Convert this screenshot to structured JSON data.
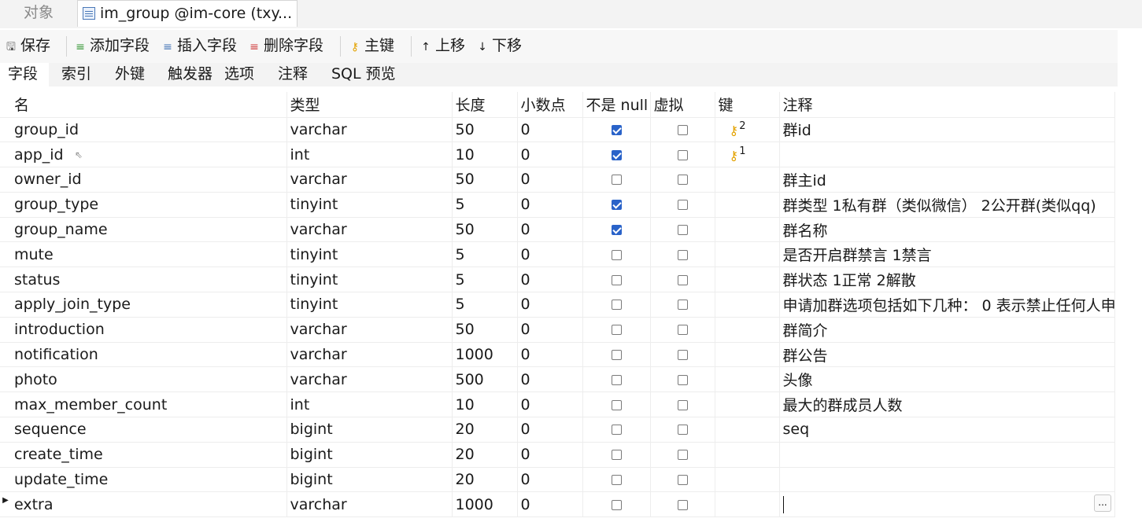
{
  "window_tabs": {
    "objects": "对象",
    "active": "im_group @im-core (txy..."
  },
  "toolbar": {
    "save": "保存",
    "add_field": "添加字段",
    "insert_field": "插入字段",
    "delete_field": "删除字段",
    "primary_key": "主键",
    "move_up": "上移",
    "move_down": "下移"
  },
  "subtabs": [
    "字段",
    "索引",
    "外键",
    "触发器",
    "选项",
    "注释",
    "SQL 预览"
  ],
  "columns": {
    "name": "名",
    "type": "类型",
    "length": "长度",
    "decimals": "小数点",
    "not_null": "不是 null",
    "virtual": "虚拟",
    "key": "键",
    "comment": "注释"
  },
  "rows": [
    {
      "name": "group_id",
      "type": "varchar",
      "length": "50",
      "decimals": "0",
      "not_null": true,
      "virtual": false,
      "key": "2",
      "comment": "群id"
    },
    {
      "name": "app_id",
      "type": "int",
      "length": "10",
      "decimals": "0",
      "not_null": true,
      "virtual": false,
      "key": "1",
      "comment": ""
    },
    {
      "name": "owner_id",
      "type": "varchar",
      "length": "50",
      "decimals": "0",
      "not_null": false,
      "virtual": false,
      "key": "",
      "comment": "群主id"
    },
    {
      "name": "group_type",
      "type": "tinyint",
      "length": "5",
      "decimals": "0",
      "not_null": true,
      "virtual": false,
      "key": "",
      "comment": "群类型 1私有群（类似微信） 2公开群(类似qq)"
    },
    {
      "name": "group_name",
      "type": "varchar",
      "length": "50",
      "decimals": "0",
      "not_null": true,
      "virtual": false,
      "key": "",
      "comment": "群名称"
    },
    {
      "name": "mute",
      "type": "tinyint",
      "length": "5",
      "decimals": "0",
      "not_null": false,
      "virtual": false,
      "key": "",
      "comment": "是否开启群禁言 1禁言"
    },
    {
      "name": "status",
      "type": "tinyint",
      "length": "5",
      "decimals": "0",
      "not_null": false,
      "virtual": false,
      "key": "",
      "comment": "群状态 1正常 2解散"
    },
    {
      "name": "apply_join_type",
      "type": "tinyint",
      "length": "5",
      "decimals": "0",
      "not_null": false,
      "virtual": false,
      "key": "",
      "comment": " 申请加群选项包括如下几种： 0 表示禁止任何人申"
    },
    {
      "name": "introduction",
      "type": "varchar",
      "length": "50",
      "decimals": "0",
      "not_null": false,
      "virtual": false,
      "key": "",
      "comment": "群简介"
    },
    {
      "name": "notification",
      "type": "varchar",
      "length": "1000",
      "decimals": "0",
      "not_null": false,
      "virtual": false,
      "key": "",
      "comment": "群公告"
    },
    {
      "name": "photo",
      "type": "varchar",
      "length": "500",
      "decimals": "0",
      "not_null": false,
      "virtual": false,
      "key": "",
      "comment": "头像"
    },
    {
      "name": "max_member_count",
      "type": "int",
      "length": "10",
      "decimals": "0",
      "not_null": false,
      "virtual": false,
      "key": "",
      "comment": "最大的群成员人数"
    },
    {
      "name": "sequence",
      "type": "bigint",
      "length": "20",
      "decimals": "0",
      "not_null": false,
      "virtual": false,
      "key": "",
      "comment": "seq"
    },
    {
      "name": "create_time",
      "type": "bigint",
      "length": "20",
      "decimals": "0",
      "not_null": false,
      "virtual": false,
      "key": "",
      "comment": ""
    },
    {
      "name": "update_time",
      "type": "bigint",
      "length": "20",
      "decimals": "0",
      "not_null": false,
      "virtual": false,
      "key": "",
      "comment": ""
    },
    {
      "name": "extra",
      "type": "varchar",
      "length": "1000",
      "decimals": "0",
      "not_null": false,
      "virtual": false,
      "key": "",
      "comment": ""
    }
  ],
  "selected_row": 15,
  "ellipsis_label": "...",
  "colors": {
    "accent": "#2a63c9",
    "key_icon": "#e3a200"
  }
}
